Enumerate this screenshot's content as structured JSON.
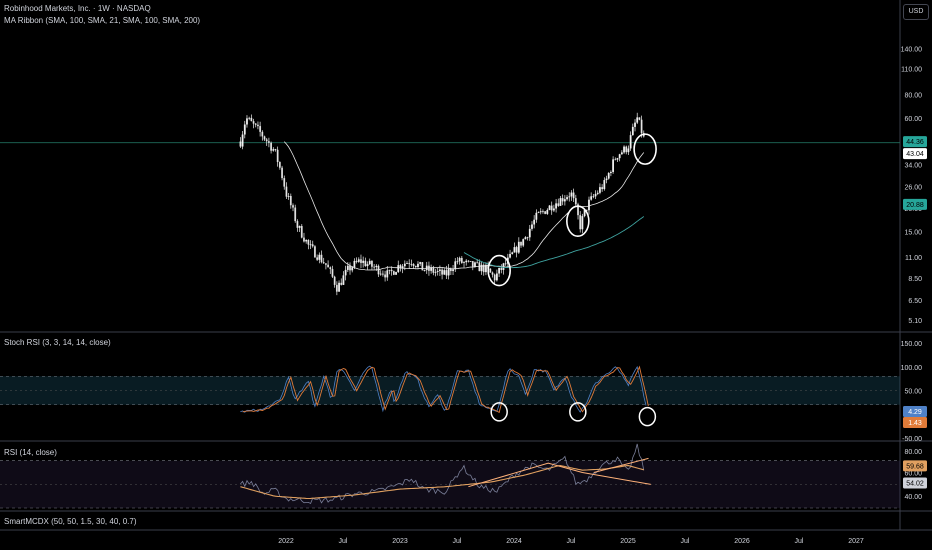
{
  "header": {
    "title": "Robinhood Markets, Inc. · 1W · NASDAQ",
    "indicator": "MA Ribbon (SMA, 100, SMA, 21, SMA, 100, SMA, 200)",
    "currency": "USD"
  },
  "colors": {
    "background": "#000000",
    "up": "#26a69a",
    "down": "#ef5350",
    "candle": "#f0f0f0",
    "sma21": "#e8e8e8",
    "sma100": "#3fa3a0",
    "stoch_k": "#4f81c7",
    "stoch_d": "#e07b39",
    "rsi_line": "#7a7f99",
    "rsi_ma": "#e0a060",
    "band": "#1a4f63"
  },
  "chart_data": [
    {
      "type": "candlestick",
      "name": "price",
      "scale": "log",
      "ylim": [
        4.5,
        180
      ],
      "x_ticks": [
        "2022",
        "Jul",
        "2023",
        "Jul",
        "2024",
        "Jul",
        "2025",
        "Jul",
        "2026",
        "Jul",
        "2027"
      ],
      "y_ticks": [
        5.1,
        6.5,
        8.5,
        11.0,
        15.0,
        20.0,
        26.0,
        34.0,
        43.04,
        60.0,
        80.0,
        110.0,
        140.0
      ],
      "price_label": "44.36",
      "secondary_label": "43.04",
      "ma_label": "20.88",
      "anchors": [
        [
          2021.6,
          45
        ],
        [
          2021.65,
          60
        ],
        [
          2021.8,
          48
        ],
        [
          2021.9,
          40
        ],
        [
          2022.0,
          24
        ],
        [
          2022.1,
          16
        ],
        [
          2022.2,
          12.5
        ],
        [
          2022.35,
          10
        ],
        [
          2022.45,
          7.5
        ],
        [
          2022.55,
          9.5
        ],
        [
          2022.65,
          10.5
        ],
        [
          2022.8,
          9.5
        ],
        [
          2022.9,
          8.8
        ],
        [
          2023.0,
          10
        ],
        [
          2023.1,
          10.5
        ],
        [
          2023.2,
          9.5
        ],
        [
          2023.3,
          9.2
        ],
        [
          2023.4,
          8.8
        ],
        [
          2023.5,
          10.5
        ],
        [
          2023.6,
          10
        ],
        [
          2023.75,
          9.5
        ],
        [
          2023.83,
          8.5
        ],
        [
          2023.95,
          10.5
        ],
        [
          2024.1,
          14
        ],
        [
          2024.2,
          18
        ],
        [
          2024.3,
          20
        ],
        [
          2024.4,
          22
        ],
        [
          2024.5,
          24
        ],
        [
          2024.58,
          16
        ],
        [
          2024.65,
          21
        ],
        [
          2024.8,
          27
        ],
        [
          2024.9,
          38
        ],
        [
          2025.0,
          42
        ],
        [
          2025.08,
          60
        ],
        [
          2025.15,
          44
        ]
      ],
      "ma21_start": 2021.9,
      "ma100_start": 2023.55,
      "annotations": [
        {
          "type": "circle",
          "x": 2023.87,
          "y": 9.3
        },
        {
          "type": "circle",
          "x": 2024.56,
          "y": 17
        },
        {
          "type": "circle",
          "x": 2025.15,
          "y": 41
        }
      ]
    },
    {
      "type": "line",
      "name": "Stoch RSI (3, 3, 14, 14, close)",
      "ylim": [
        -50,
        150
      ],
      "y_ticks": [
        150.0,
        100.0,
        50.0,
        -50.0
      ],
      "bands": [
        80,
        20
      ],
      "k_label": "4.29",
      "d_label": "1.43",
      "anchors": [
        [
          2021.6,
          5
        ],
        [
          2021.8,
          10
        ],
        [
          2021.95,
          30
        ],
        [
          2022.02,
          80
        ],
        [
          2022.08,
          30
        ],
        [
          2022.12,
          45
        ],
        [
          2022.2,
          70
        ],
        [
          2022.25,
          15
        ],
        [
          2022.33,
          80
        ],
        [
          2022.4,
          30
        ],
        [
          2022.45,
          95
        ],
        [
          2022.5,
          95
        ],
        [
          2022.6,
          50
        ],
        [
          2022.7,
          95
        ],
        [
          2022.75,
          100
        ],
        [
          2022.85,
          10
        ],
        [
          2022.92,
          55
        ],
        [
          2022.95,
          25
        ],
        [
          2023.05,
          90
        ],
        [
          2023.15,
          75
        ],
        [
          2023.25,
          15
        ],
        [
          2023.33,
          40
        ],
        [
          2023.4,
          5
        ],
        [
          2023.5,
          90
        ],
        [
          2023.6,
          90
        ],
        [
          2023.7,
          20
        ],
        [
          2023.85,
          5
        ],
        [
          2023.95,
          95
        ],
        [
          2024.05,
          80
        ],
        [
          2024.1,
          40
        ],
        [
          2024.18,
          95
        ],
        [
          2024.28,
          90
        ],
        [
          2024.35,
          50
        ],
        [
          2024.45,
          80
        ],
        [
          2024.5,
          40
        ],
        [
          2024.58,
          5
        ],
        [
          2024.65,
          30
        ],
        [
          2024.7,
          60
        ],
        [
          2024.78,
          80
        ],
        [
          2024.85,
          90
        ],
        [
          2024.9,
          100
        ],
        [
          2024.95,
          80
        ],
        [
          2025.0,
          60
        ],
        [
          2025.08,
          100
        ],
        [
          2025.12,
          60
        ],
        [
          2025.17,
          5
        ]
      ],
      "annotations": [
        {
          "type": "circle",
          "x": 2023.87,
          "y": 5
        },
        {
          "type": "circle",
          "x": 2024.56,
          "y": 5
        },
        {
          "type": "circle",
          "x": 2025.17,
          "y": -5
        }
      ]
    },
    {
      "type": "line",
      "name": "RSI (14, close)",
      "ylim": [
        30,
        85
      ],
      "y_ticks": [
        80.0,
        60.0,
        40.0
      ],
      "bands": [
        70,
        30
      ],
      "rsi_label": "59.68",
      "ma_label": "54.02",
      "anchors": [
        [
          2021.6,
          50
        ],
        [
          2021.7,
          52
        ],
        [
          2021.8,
          42
        ],
        [
          2021.9,
          45
        ],
        [
          2022.0,
          38
        ],
        [
          2022.2,
          36
        ],
        [
          2022.4,
          37
        ],
        [
          2022.6,
          42
        ],
        [
          2022.8,
          44
        ],
        [
          2023.0,
          50
        ],
        [
          2023.1,
          55
        ],
        [
          2023.2,
          46
        ],
        [
          2023.4,
          44
        ],
        [
          2023.55,
          65
        ],
        [
          2023.7,
          48
        ],
        [
          2023.85,
          44
        ],
        [
          2024.0,
          58
        ],
        [
          2024.15,
          66
        ],
        [
          2024.3,
          62
        ],
        [
          2024.45,
          72
        ],
        [
          2024.55,
          50
        ],
        [
          2024.65,
          55
        ],
        [
          2024.75,
          65
        ],
        [
          2024.9,
          72
        ],
        [
          2025.0,
          60
        ],
        [
          2025.08,
          82
        ],
        [
          2025.15,
          60
        ]
      ],
      "ma_anchors": [
        [
          2021.6,
          48
        ],
        [
          2021.9,
          40
        ],
        [
          2022.2,
          38
        ],
        [
          2022.6,
          41
        ],
        [
          2023.0,
          46
        ],
        [
          2023.4,
          48
        ],
        [
          2023.8,
          52
        ],
        [
          2024.1,
          58
        ],
        [
          2024.4,
          66
        ],
        [
          2024.6,
          62
        ],
        [
          2024.8,
          63
        ],
        [
          2025.0,
          66
        ],
        [
          2025.15,
          62
        ]
      ],
      "trendlines": [
        {
          "points": [
            [
              2023.6,
              48
            ],
            [
              2024.3,
              68
            ],
            [
              2024.6,
              60
            ],
            [
              2025.2,
              50
            ]
          ]
        },
        {
          "points": [
            [
              2024.7,
              60
            ],
            [
              2025.1,
              70
            ],
            [
              2025.18,
              72
            ]
          ]
        }
      ]
    }
  ],
  "panels": {
    "smartmcdx": "SmartMCDX (50, 50, 1.5, 30, 40, 0.7)"
  }
}
